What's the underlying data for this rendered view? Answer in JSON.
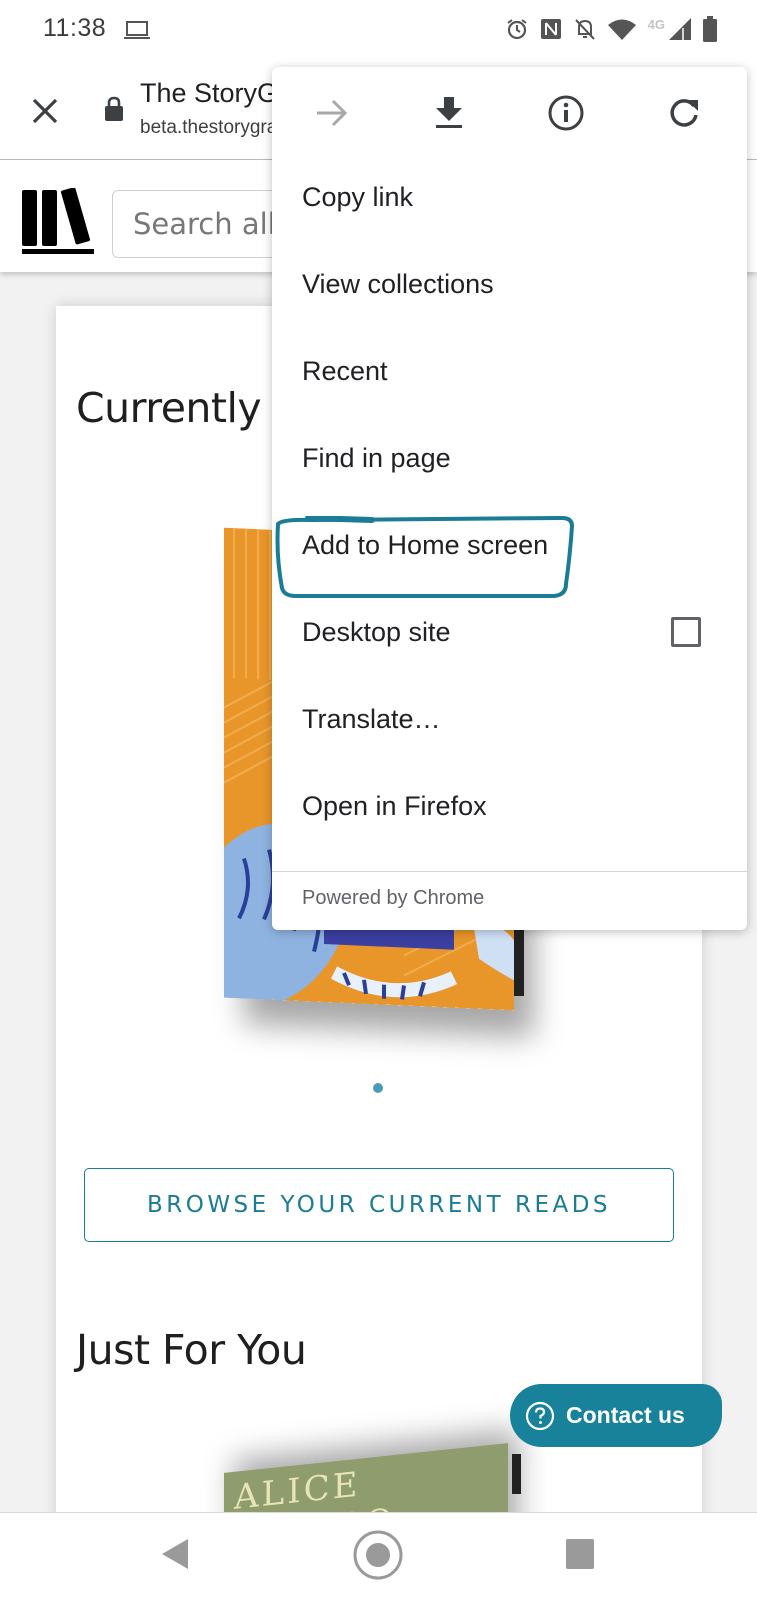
{
  "status_bar": {
    "time": "11:38",
    "network_label": "4G",
    "icons": [
      "laptop-icon",
      "alarm-icon",
      "nfc-icon",
      "bell-off-icon",
      "wifi-icon",
      "signal-icon",
      "battery-icon"
    ]
  },
  "toolbar": {
    "title": "The StoryGraph",
    "url": "beta.thestorygraph.com",
    "close_icon": "close-icon",
    "lock_icon": "lock-icon"
  },
  "site_header": {
    "logo": "bookshelf-logo-icon",
    "search_placeholder": "Search all books"
  },
  "main": {
    "currently_reading_title": "Currently Reading",
    "browse_button_label": "BROWSE YOUR CURRENT READS",
    "just_for_you_title": "Just For You",
    "recommended_book_author": "ALICE MUNRO",
    "carousel_dots": 1
  },
  "contact": {
    "label": "Contact us",
    "icon": "help-circle-icon"
  },
  "menu": {
    "top_icons": [
      "forward-icon",
      "download-icon",
      "info-icon",
      "reload-icon"
    ],
    "items": [
      {
        "label": "Copy link"
      },
      {
        "label": "View collections"
      },
      {
        "label": "Recent"
      },
      {
        "label": "Find in page"
      },
      {
        "label": "Add to Home screen",
        "highlighted": true
      },
      {
        "label": "Desktop site",
        "checkbox": false
      },
      {
        "label": "Translate…"
      },
      {
        "label": "Open in Firefox"
      }
    ],
    "footer": "Powered by Chrome"
  },
  "colors": {
    "accent": "#17829a",
    "annotation": "#1a7c95",
    "button_text": "#1a7c95"
  },
  "nav_bar": {
    "icons": [
      "back-icon",
      "home-icon",
      "recents-icon"
    ]
  }
}
